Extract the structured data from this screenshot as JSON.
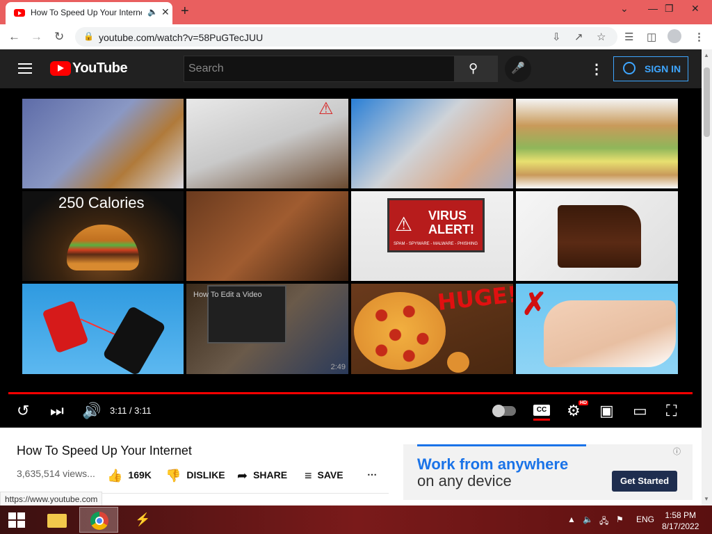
{
  "browser": {
    "tab_title": "How To Speed Up Your Internet",
    "url": "youtube.com/watch?v=58PuGTecJUU",
    "status_url": "https://www.youtube.com"
  },
  "youtube": {
    "logo_text": "YouTube",
    "search_placeholder": "Search",
    "sign_in": "SIGN IN"
  },
  "player": {
    "thumbnail_captions": {
      "calories": "250 Calories",
      "virus_title": "VIRUS ALERT!",
      "virus_sub": "SPAM - SPYWARE - MALWARE - PHISHING",
      "huge": "HUGE!",
      "inner_title": "How To Edit a Video",
      "inner_duration": "2:49"
    },
    "time": "3:11 / 3:11",
    "progress": 1.0,
    "cc": "CC",
    "hd": "HD"
  },
  "video": {
    "title": "How To Speed Up Your Internet",
    "views": "3,635,514 views...",
    "likes": "169K",
    "dislike": "DISLIKE",
    "share": "SHARE",
    "save": "SAVE"
  },
  "ad": {
    "line1": "Work from anywhere",
    "line2": "on any device",
    "cta": "Get Started"
  },
  "taskbar": {
    "lang": "ENG",
    "time": "1:58 PM",
    "date": "8/17/2022"
  },
  "colors": {
    "brand_red": "#ff0000",
    "link_blue": "#3ea6ff",
    "tab_strip": "#e95f5f"
  }
}
